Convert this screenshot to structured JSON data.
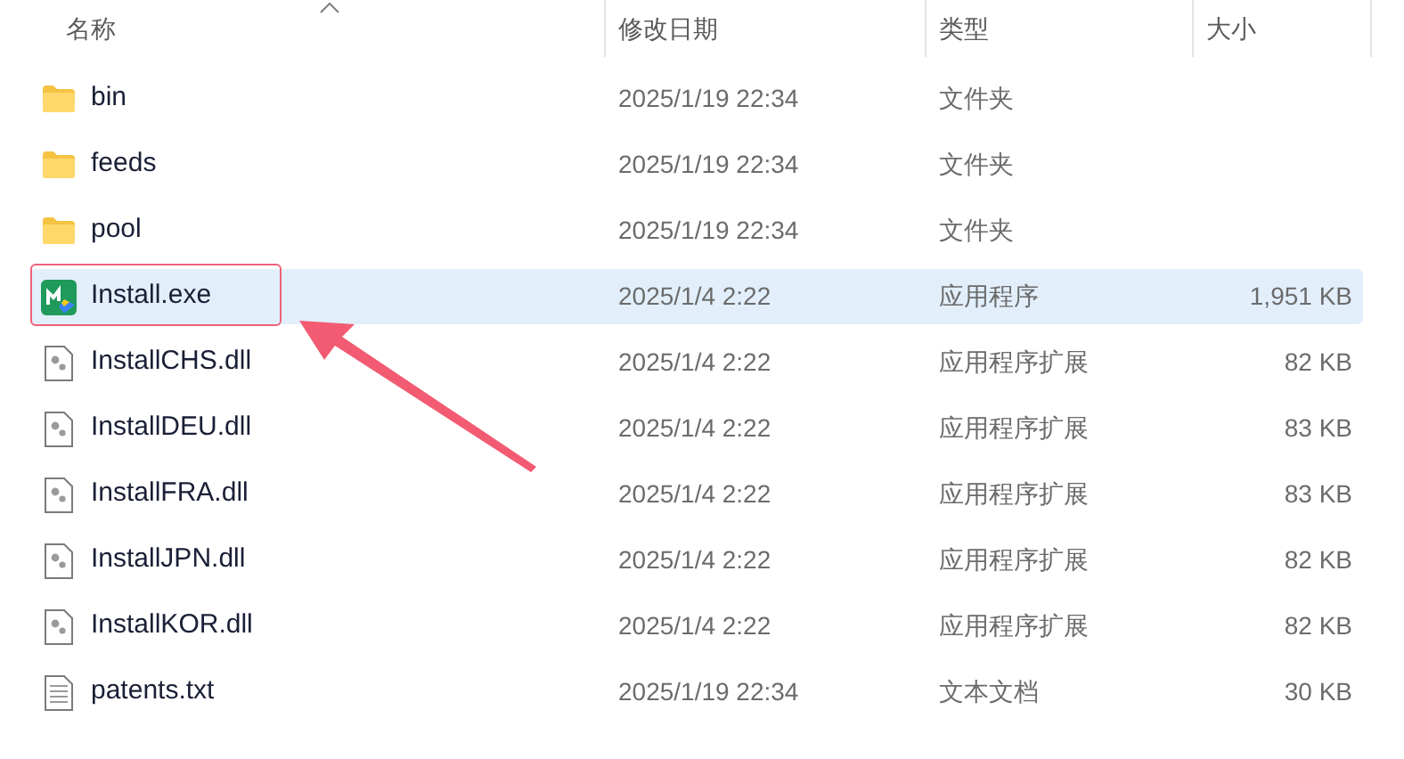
{
  "columns": [
    {
      "label": "名称",
      "sorted": true
    },
    {
      "label": "修改日期",
      "sorted": false
    },
    {
      "label": "类型",
      "sorted": false
    },
    {
      "label": "大小",
      "sorted": false
    }
  ],
  "rows": [
    {
      "kind": "folder",
      "name": "bin",
      "date": "2025/1/19 22:34",
      "type": "文件夹",
      "selected": false
    },
    {
      "kind": "folder",
      "name": "feeds",
      "date": "2025/1/19 22:34",
      "type": "文件夹",
      "selected": false
    },
    {
      "kind": "folder",
      "name": "pool",
      "date": "2025/1/19 22:34",
      "type": "文件夹",
      "selected": false
    },
    {
      "kind": "exe",
      "name": "Install.exe",
      "date": "2025/1/4 2:22",
      "type": "应用程序",
      "size": "1,951 KB",
      "selected": true
    },
    {
      "kind": "dll",
      "name": "InstallCHS.dll",
      "date": "2025/1/4 2:22",
      "type": "应用程序扩展",
      "size": "82 KB",
      "selected": false
    },
    {
      "kind": "dll",
      "name": "InstallDEU.dll",
      "date": "2025/1/4 2:22",
      "type": "应用程序扩展",
      "size": "83 KB",
      "selected": false
    },
    {
      "kind": "dll",
      "name": "InstallFRA.dll",
      "date": "2025/1/4 2:22",
      "type": "应用程序扩展",
      "size": "83 KB",
      "selected": false
    },
    {
      "kind": "dll",
      "name": "InstallJPN.dll",
      "date": "2025/1/4 2:22",
      "type": "应用程序扩展",
      "size": "82 KB",
      "selected": false
    },
    {
      "kind": "dll",
      "name": "InstallKOR.dll",
      "date": "2025/1/4 2:22",
      "type": "应用程序扩展",
      "size": "82 KB",
      "selected": false
    },
    {
      "kind": "txt",
      "name": "patents.txt",
      "date": "2025/1/19 22:34",
      "type": "文本文档",
      "size": "30 KB",
      "selected": false
    }
  ]
}
